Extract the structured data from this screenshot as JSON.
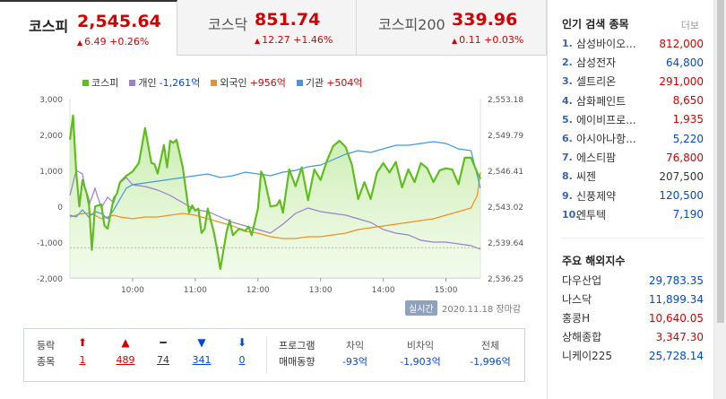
{
  "tabs": [
    {
      "name": "코스피",
      "value": "2,545.64",
      "change": "6.49 +0.26%",
      "active": true
    },
    {
      "name": "코스닥",
      "value": "851.74",
      "change": "12.27 +1.46%",
      "active": false
    },
    {
      "name": "코스피200",
      "value": "339.96",
      "change": "0.11 +0.03%",
      "active": false
    }
  ],
  "legend": [
    {
      "label": "코스피",
      "value": "",
      "color": "#5fbe1e"
    },
    {
      "label": "개인",
      "value": "-1,261억",
      "color": "#9b7fcf",
      "sign": "neg"
    },
    {
      "label": "외국인",
      "value": "+956억",
      "color": "#f0901e",
      "sign": "pos"
    },
    {
      "label": "기관",
      "value": "+504억",
      "color": "#3d9ae6",
      "sign": "pos"
    }
  ],
  "chart_data": {
    "type": "line",
    "x_ticks": [
      "10:00",
      "11:00",
      "12:00",
      "13:00",
      "14:00",
      "15:00"
    ],
    "y_left_ticks": [
      "3,000",
      "2,000",
      "1,000",
      "0",
      "-1,000",
      "-2,000"
    ],
    "y_left_range": [
      -2000,
      3000
    ],
    "y_right_ticks": [
      "2,553.18",
      "2,549.79",
      "2,546.41",
      "2,543.02",
      "2,539.64",
      "2,536.25"
    ],
    "y_right_range": [
      2536.25,
      2553.18
    ],
    "x_range": [
      9.0,
      15.55
    ],
    "series": [
      {
        "name": "코스피",
        "axis": "right",
        "color": "#5fbe1e",
        "x": [
          9.0,
          9.05,
          9.1,
          9.15,
          9.2,
          9.3,
          9.35,
          9.4,
          9.5,
          9.55,
          9.6,
          9.7,
          9.75,
          9.8,
          9.9,
          10.0,
          10.1,
          10.2,
          10.3,
          10.35,
          10.4,
          10.5,
          10.55,
          10.6,
          10.65,
          10.7,
          10.8,
          10.9,
          10.95,
          11.0,
          11.05,
          11.1,
          11.15,
          11.2,
          11.3,
          11.35,
          11.4,
          11.5,
          11.55,
          11.6,
          11.7,
          11.8,
          11.85,
          11.9,
          12.0,
          12.05,
          12.1,
          12.2,
          12.3,
          12.35,
          12.4,
          12.5,
          12.6,
          12.7,
          12.8,
          12.9,
          13.0,
          13.1,
          13.2,
          13.3,
          13.4,
          13.5,
          13.6,
          13.7,
          13.8,
          13.9,
          14.0,
          14.1,
          14.2,
          14.3,
          14.4,
          14.5,
          14.6,
          14.7,
          14.8,
          14.9,
          15.0,
          15.1,
          15.2,
          15.3,
          15.4,
          15.5,
          15.55
        ],
        "y": [
          2549.3,
          2551.6,
          2546.3,
          2543.0,
          2545.5,
          2543.6,
          2538.9,
          2543.0,
          2543.2,
          2541.2,
          2540.9,
          2543.8,
          2544.2,
          2545.3,
          2545.9,
          2546.3,
          2547.1,
          2550.4,
          2547.1,
          2547.0,
          2546.1,
          2548.8,
          2546.7,
          2549.2,
          2549.0,
          2549.3,
          2546.7,
          2542.4,
          2543.1,
          2542.6,
          2542.8,
          2540.5,
          2540.9,
          2542.8,
          2540.5,
          2538.9,
          2537.1,
          2540.6,
          2541.7,
          2540.3,
          2540.9,
          2540.7,
          2541.1,
          2540.3,
          2542.8,
          2546.3,
          2545.7,
          2543.0,
          2543.1,
          2543.6,
          2542.4,
          2546.5,
          2544.9,
          2546.7,
          2543.6,
          2546.5,
          2545.5,
          2547.3,
          2548.7,
          2549.2,
          2548.6,
          2546.9,
          2543.7,
          2545.3,
          2543.7,
          2546.2,
          2547.1,
          2546.2,
          2547.2,
          2544.8,
          2546.5,
          2545.3,
          2547.1,
          2546.6,
          2545.3,
          2546.4,
          2546.6,
          2546.5,
          2545.1,
          2547.6,
          2547.6,
          2546.2,
          2545.6
        ]
      },
      {
        "name": "개인",
        "axis": "left",
        "color": "#9b7fcf",
        "x": [
          9.0,
          9.1,
          9.2,
          9.3,
          9.4,
          9.5,
          9.6,
          9.7,
          9.8,
          9.9,
          10.0,
          10.2,
          10.4,
          10.6,
          10.8,
          11.0,
          11.2,
          11.4,
          11.6,
          11.8,
          12.0,
          12.2,
          12.4,
          12.6,
          12.8,
          13.0,
          13.2,
          13.4,
          13.6,
          13.8,
          14.0,
          14.2,
          14.4,
          14.6,
          14.8,
          15.0,
          15.2,
          15.4,
          15.55
        ],
        "y": [
          300,
          1000,
          900,
          0,
          500,
          -50,
          250,
          100,
          650,
          800,
          600,
          550,
          450,
          300,
          100,
          -100,
          -150,
          -300,
          -450,
          -550,
          -650,
          -750,
          -500,
          -200,
          -50,
          -150,
          -200,
          -250,
          -350,
          -450,
          -650,
          -750,
          -800,
          -950,
          -1000,
          -1000,
          -1050,
          -1100,
          -1200
        ]
      },
      {
        "name": "외국인",
        "axis": "left",
        "color": "#f0901e",
        "x": [
          9.0,
          9.1,
          9.2,
          9.3,
          9.4,
          9.5,
          9.6,
          9.7,
          9.8,
          10.0,
          10.2,
          10.4,
          10.6,
          10.8,
          11.0,
          11.2,
          11.4,
          11.6,
          11.8,
          12.0,
          12.2,
          12.4,
          12.6,
          12.8,
          13.0,
          13.2,
          13.4,
          13.6,
          13.8,
          14.0,
          14.2,
          14.4,
          14.6,
          14.8,
          15.0,
          15.2,
          15.4,
          15.5,
          15.55
        ],
        "y": [
          -300,
          -250,
          -200,
          -200,
          -250,
          -350,
          -300,
          -250,
          -300,
          -350,
          -300,
          -300,
          -250,
          -200,
          -250,
          -350,
          -450,
          -550,
          -700,
          -750,
          -850,
          -900,
          -900,
          -850,
          -850,
          -800,
          -750,
          -650,
          -600,
          -550,
          -500,
          -450,
          -400,
          -350,
          -250,
          -150,
          -50,
          300,
          950
        ]
      },
      {
        "name": "기관",
        "axis": "left",
        "color": "#3d9ae6",
        "x": [
          9.0,
          9.1,
          9.2,
          9.3,
          9.4,
          9.5,
          9.6,
          9.7,
          9.8,
          9.9,
          10.0,
          10.2,
          10.4,
          10.6,
          10.8,
          11.0,
          11.2,
          11.4,
          11.6,
          11.8,
          12.0,
          12.2,
          12.4,
          12.6,
          12.8,
          13.0,
          13.2,
          13.4,
          13.6,
          13.8,
          14.0,
          14.2,
          14.4,
          14.6,
          14.8,
          15.0,
          15.2,
          15.4,
          15.55
        ],
        "y": [
          -250,
          -300,
          -100,
          -300,
          -150,
          -200,
          -350,
          -100,
          200,
          500,
          600,
          650,
          700,
          750,
          800,
          850,
          900,
          800,
          850,
          950,
          900,
          850,
          950,
          1000,
          1100,
          1150,
          1300,
          1450,
          1550,
          1500,
          1600,
          1700,
          1700,
          1750,
          1800,
          1750,
          1600,
          1550,
          500
        ]
      }
    ]
  },
  "realtime_badge": "실시간",
  "date_label": "2020.11.18 장마감",
  "advance_decline": {
    "label_line1": "등락",
    "label_line2": "종목",
    "items": [
      {
        "icon": "arrow-up-bold",
        "count": "1",
        "color": "#d60000",
        "glyph": "⬆"
      },
      {
        "icon": "triangle-up",
        "count": "489",
        "color": "#d60000",
        "glyph": "▲"
      },
      {
        "icon": "flat-dash",
        "count": "74",
        "color": "#333333",
        "glyph": "━"
      },
      {
        "icon": "triangle-down",
        "count": "341",
        "color": "#0048d6",
        "glyph": "▼"
      },
      {
        "icon": "arrow-down-bold",
        "count": "0",
        "color": "#0048d6",
        "glyph": "⬇"
      }
    ]
  },
  "program_trading": {
    "label_line1": "프로그램",
    "label_line2": "매매동향",
    "columns": [
      {
        "header": "차익",
        "value": "-93억"
      },
      {
        "header": "비차익",
        "value": "-1,903억"
      },
      {
        "header": "전체",
        "value": "-1,996억"
      }
    ]
  },
  "popular": {
    "title": "인기 검색 종목",
    "more": "더보",
    "items": [
      {
        "rank": "1.",
        "name": "삼성바이오...",
        "price": "812,000",
        "dir": "up"
      },
      {
        "rank": "2.",
        "name": "삼성전자",
        "price": "64,800",
        "dir": "down"
      },
      {
        "rank": "3.",
        "name": "셀트리온",
        "price": "291,000",
        "dir": "up"
      },
      {
        "rank": "4.",
        "name": "삼화페인트",
        "price": "8,650",
        "dir": "up"
      },
      {
        "rank": "5.",
        "name": "에이비프로...",
        "price": "1,935",
        "dir": "up"
      },
      {
        "rank": "6.",
        "name": "아시아나항...",
        "price": "5,220",
        "dir": "down"
      },
      {
        "rank": "7.",
        "name": "에스티팜",
        "price": "76,800",
        "dir": "up"
      },
      {
        "rank": "8.",
        "name": "씨젠",
        "price": "207,500",
        "dir": "flat"
      },
      {
        "rank": "9.",
        "name": "신풍제약",
        "price": "120,500",
        "dir": "down"
      },
      {
        "rank": "10.",
        "name": "엔투텍",
        "price": "7,190",
        "dir": "down"
      }
    ]
  },
  "world_indices": {
    "title": "주요 해외지수",
    "items": [
      {
        "name": "다우산업",
        "value": "29,783.35",
        "dir": "down"
      },
      {
        "name": "나스닥",
        "value": "11,899.34",
        "dir": "down"
      },
      {
        "name": "홍콩H",
        "value": "10,640.05",
        "dir": "up"
      },
      {
        "name": "상해종합",
        "value": "3,347.30",
        "dir": "up"
      },
      {
        "name": "니케이225",
        "value": "25,728.14",
        "dir": "down"
      }
    ]
  }
}
